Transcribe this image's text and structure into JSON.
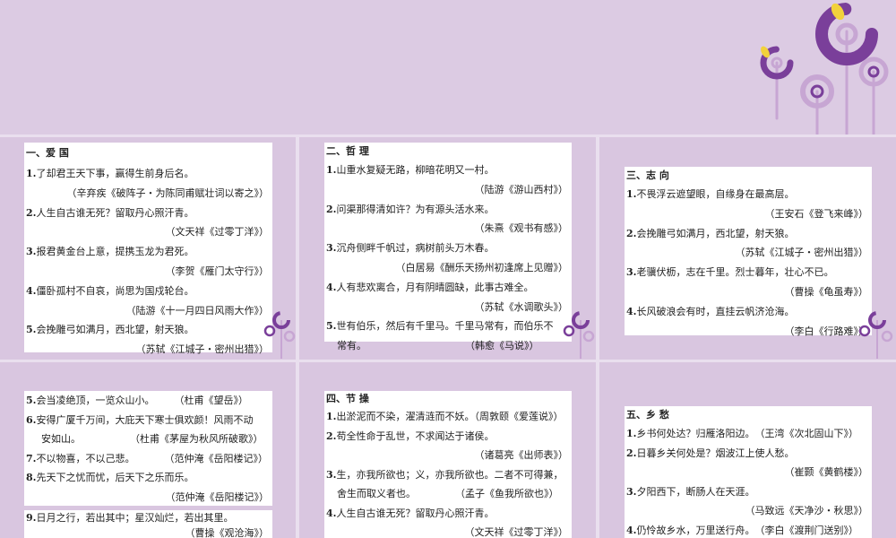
{
  "panels": [
    {
      "heading": "一、爱 国",
      "lines": [
        {
          "type": "text",
          "num": "1.",
          "text": "了却君王天下事，赢得生前身后名。"
        },
        {
          "type": "src",
          "text": "（辛弃疾《破阵子・为陈同甫赋壮词以寄之》）"
        },
        {
          "type": "text",
          "num": "2.",
          "text": "人生自古谁无死？留取丹心照汗青。"
        },
        {
          "type": "src",
          "text": "（文天祥《过零丁洋》）"
        },
        {
          "type": "text",
          "num": "3.",
          "text": "报君黄金台上意，提携玉龙为君死。"
        },
        {
          "type": "src",
          "text": "（李贺《雁门太守行》）"
        },
        {
          "type": "text",
          "num": "4.",
          "text": "僵卧孤村不自哀，尚思为国戍轮台。"
        },
        {
          "type": "src",
          "text": "（陆游《十一月四日风雨大作》）"
        },
        {
          "type": "text",
          "num": "5.",
          "text": "会挽雕弓如满月，西北望，射天狼。"
        },
        {
          "type": "src",
          "text": "（苏轼《江城子・密州出猎》）"
        }
      ]
    },
    {
      "heading": "二、哲 理",
      "lines": [
        {
          "type": "text",
          "num": "1.",
          "text": "山重水复疑无路，柳暗花明又一村。"
        },
        {
          "type": "src",
          "text": "（陆游《游山西村》）"
        },
        {
          "type": "text",
          "num": "2.",
          "text": "问渠那得清如许？为有源头活水来。"
        },
        {
          "type": "src",
          "text": "（朱熹《观书有感》）"
        },
        {
          "type": "text",
          "num": "3.",
          "text": "沉舟侧畔千帆过，病树前头万木春。"
        },
        {
          "type": "src",
          "text": "（白居易《酬乐天扬州初逢席上见赠》）"
        },
        {
          "type": "text",
          "num": "4.",
          "text": "人有悲欢离合，月有阴晴圆缺，此事古难全。"
        },
        {
          "type": "src",
          "text": "（苏轼《水调歌头》）"
        },
        {
          "type": "text",
          "num": "5.",
          "text": "世有伯乐，然后有千里马。千里马常有，而伯乐不"
        },
        {
          "type": "text",
          "num": "",
          "text": "常有。　　　　　　　　　　　（韩愈《马说》）"
        }
      ]
    },
    {
      "heading": "三、志 向",
      "lines": [
        {
          "type": "text",
          "num": "1.",
          "text": "不畏浮云遮望眼，自缘身在最高层。"
        },
        {
          "type": "src",
          "text": "（王安石《登飞来峰》）"
        },
        {
          "type": "text",
          "num": "2.",
          "text": "会挽雕弓如满月，西北望，射天狼。"
        },
        {
          "type": "src",
          "text": "（苏轼《江城子・密州出猎》）"
        },
        {
          "type": "text",
          "num": "3.",
          "text": "老骥伏枥，志在千里。烈士暮年，壮心不已。"
        },
        {
          "type": "src",
          "text": "（曹操《龟虽寿》）"
        },
        {
          "type": "text",
          "num": "4.",
          "text": "长风破浪会有时，直挂云帆济沧海。"
        },
        {
          "type": "src",
          "text": "（李白《行路难》）"
        }
      ]
    },
    {
      "heading": "",
      "lines": [
        {
          "type": "text",
          "num": "5.",
          "text": "会当凌绝顶，一览众山小。　　　（杜甫《望岳》）"
        },
        {
          "type": "text",
          "num": "6.",
          "text": "安得广厦千万间，大庇天下寒士俱欢颜！风雨不动"
        },
        {
          "type": "text",
          "num": "",
          "text": "　安如山。　　　　　　（杜甫《茅屋为秋风所破歌》）"
        },
        {
          "type": "text",
          "num": "7.",
          "text": "不以物喜，不以己悲。　　　　（范仲淹《岳阳楼记》）"
        },
        {
          "type": "text",
          "num": "8.",
          "text": "先天下之忧而忧，后天下之乐而乐。"
        },
        {
          "type": "src",
          "text": "（范仲淹《岳阳楼记》）"
        },
        {
          "type": "text",
          "num": "9.",
          "text": "日月之行，若出其中；星汉灿烂，若出其里。"
        },
        {
          "type": "src",
          "text": "（曹操《观沧海》）"
        }
      ]
    },
    {
      "heading": "四、节 操",
      "lines": [
        {
          "type": "text",
          "num": "1.",
          "text": "出淤泥而不染，濯清涟而不妖。（周敦颐《爱莲说》）"
        },
        {
          "type": "text",
          "num": "2.",
          "text": "苟全性命于乱世，不求闻达于诸侯。"
        },
        {
          "type": "src",
          "text": "（诸葛亮《出师表》）"
        },
        {
          "type": "text",
          "num": "3.",
          "text": "生，亦我所欲也；义，亦我所欲也。二者不可得兼，"
        },
        {
          "type": "text",
          "num": "",
          "text": "舍生而取义者也。　　　　　（孟子《鱼我所欲也》）"
        },
        {
          "type": "text",
          "num": "4.",
          "text": "人生自古谁无死？留取丹心照汗青。"
        },
        {
          "type": "src",
          "text": "（文天祥《过零丁洋》）"
        }
      ]
    },
    {
      "heading": "五、乡 愁",
      "lines": [
        {
          "type": "text",
          "num": "1.",
          "text": "乡书何处达？归雁洛阳边。　（王湾《次北固山下》）"
        },
        {
          "type": "text",
          "num": "2.",
          "text": "日暮乡关何处是？烟波江上使人愁。"
        },
        {
          "type": "src",
          "text": "（崔颢《黄鹤楼》）"
        },
        {
          "type": "text",
          "num": "3.",
          "text": "夕阳西下，断肠人在天涯。"
        },
        {
          "type": "src",
          "text": "（马致远《天净沙・秋思》）"
        },
        {
          "type": "text",
          "num": "4.",
          "text": "仍怜故乡水，万里送行舟。　（李白《渡荆门送别》）"
        }
      ]
    }
  ],
  "colors": {
    "background": "#d9c6e0",
    "panel": "#ffffff",
    "deco_purple": "#7a3f9a",
    "deco_lilac": "#c7a6d3",
    "deco_yellow": "#f2d23b"
  },
  "icons": [
    "flower-circle-decoration-icon"
  ]
}
